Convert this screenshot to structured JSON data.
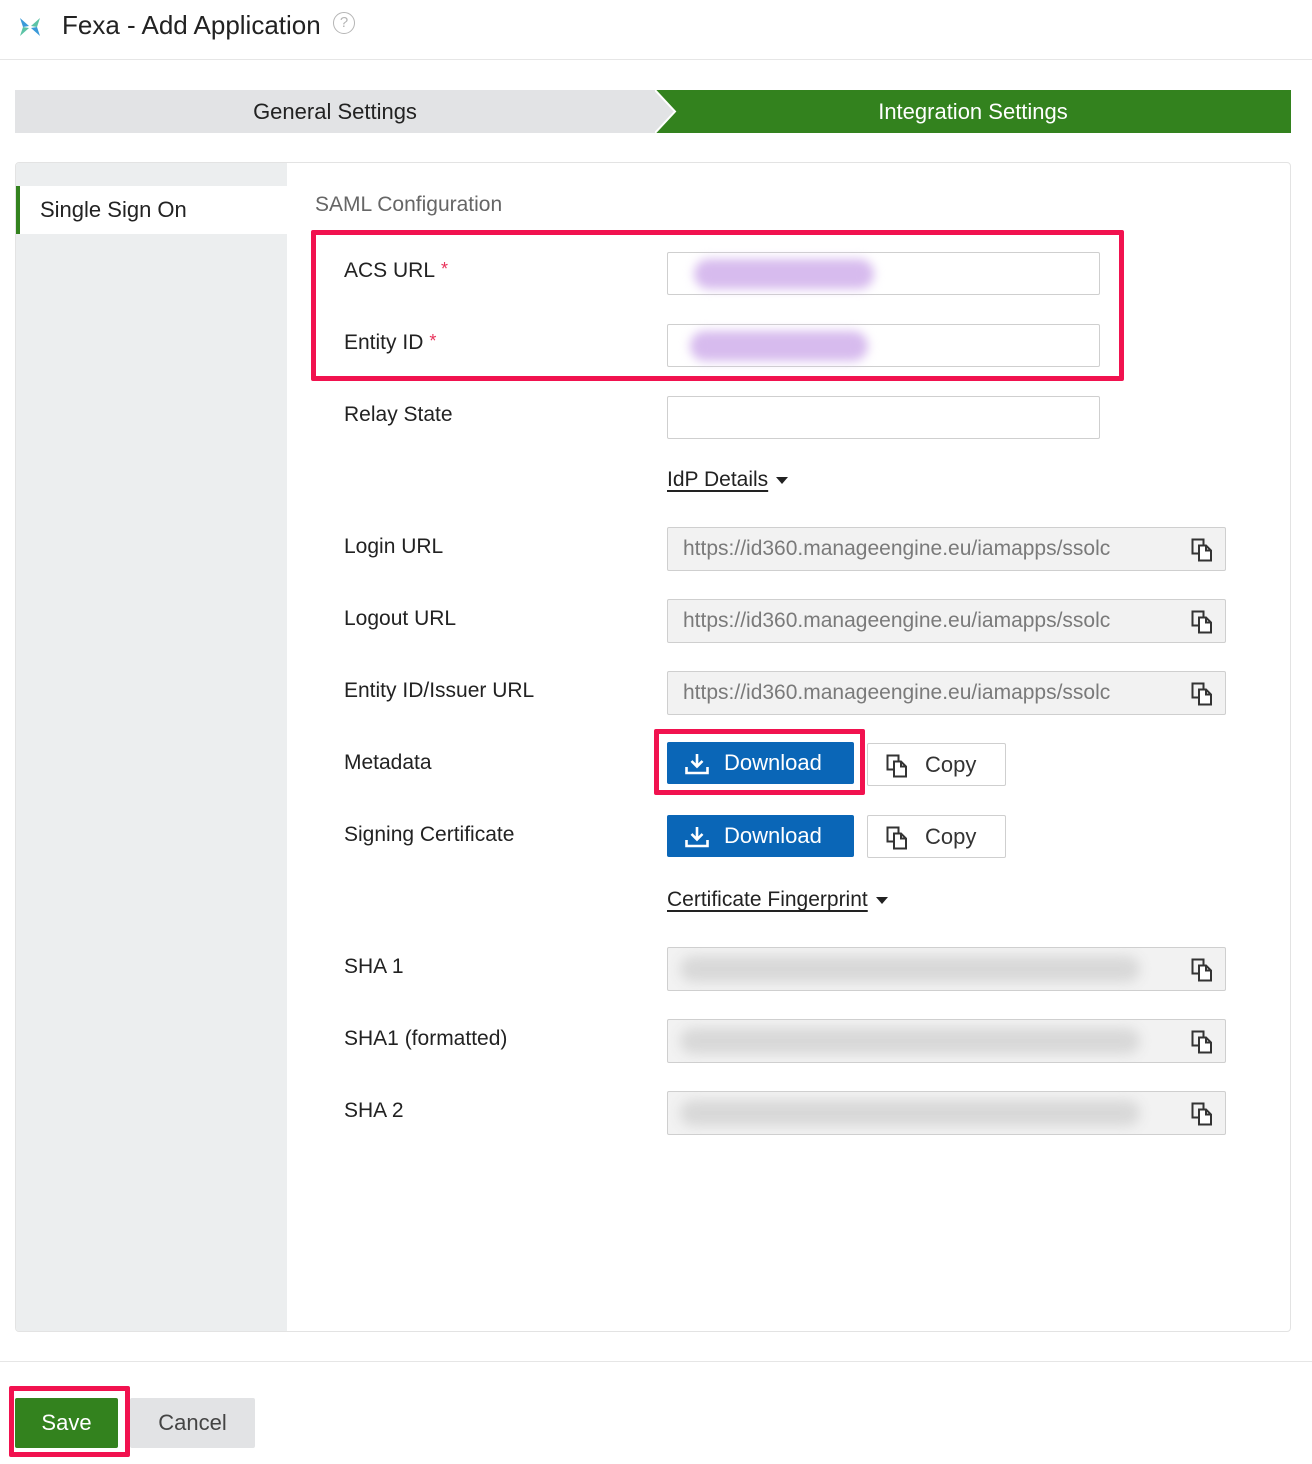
{
  "header": {
    "title": "Fexa - Add Application",
    "help_icon": "question-circle-icon",
    "help_glyph": "?"
  },
  "steps": {
    "general": "General Settings",
    "integration": "Integration Settings",
    "active": "Integration Settings"
  },
  "sidebar": {
    "items": [
      {
        "label": "Single Sign On",
        "selected": true
      }
    ]
  },
  "saml": {
    "section_title": "SAML Configuration",
    "acs_url": {
      "label": "ACS URL",
      "required_mark": "*"
    },
    "entity_id": {
      "label": "Entity ID",
      "required_mark": "*"
    },
    "relay_state": {
      "label": "Relay State"
    },
    "idp_details_label": "IdP Details",
    "login_url": {
      "label": "Login URL",
      "value": "https://id360.manageengine.eu/iamapps/ssolc"
    },
    "logout_url": {
      "label": "Logout URL",
      "value": "https://id360.manageengine.eu/iamapps/ssolc"
    },
    "entity_issuer_url": {
      "label": "Entity ID/Issuer URL",
      "value": "https://id360.manageengine.eu/iamapps/ssolc"
    },
    "metadata": {
      "label": "Metadata",
      "download_label": "Download",
      "copy_label": "Copy"
    },
    "signing_certificate": {
      "label": "Signing Certificate",
      "download_label": "Download",
      "copy_label": "Copy"
    },
    "certificate_fingerprint_label": "Certificate Fingerprint",
    "sha1": {
      "label": "SHA 1"
    },
    "sha1_formatted": {
      "label": "SHA1 (formatted)"
    },
    "sha2": {
      "label": "SHA 2"
    }
  },
  "footer": {
    "save_label": "Save",
    "cancel_label": "Cancel"
  },
  "colors": {
    "accent_green": "#33821e",
    "primary_blue": "#0a66b7",
    "highlight_pink": "#f1124f",
    "required_red": "#e8325a"
  }
}
